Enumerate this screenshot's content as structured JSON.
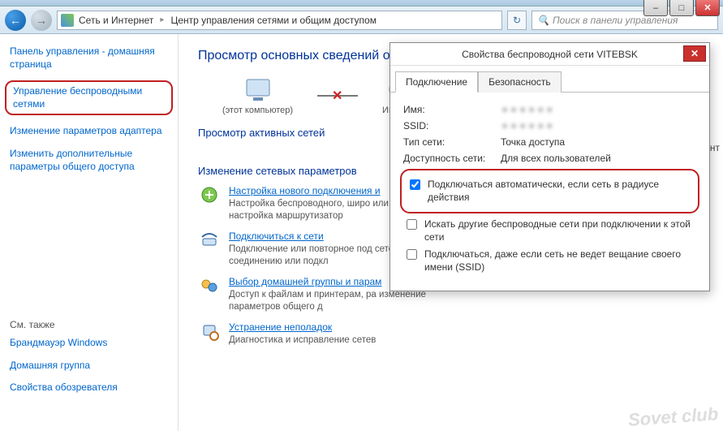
{
  "window": {
    "minimize": "–",
    "maximize": "□",
    "close": "✕"
  },
  "nav": {
    "back": "←",
    "forward": "→",
    "breadcrumb1": "Сеть и Интернет",
    "breadcrumb2": "Центр управления сетями и общим доступом",
    "refresh": "↻",
    "search_placeholder": "Поиск в панели управления",
    "search_icon": "🔍"
  },
  "sidebar": {
    "home": "Панель управления - домашняя страница",
    "wireless": "Управление беспроводными сетями",
    "adapter": "Изменение параметров адаптера",
    "sharing": "Изменить дополнительные параметры общего доступа",
    "seealso_title": "См. также",
    "seealso": {
      "firewall": "Брандмауэр Windows",
      "homegroup": "Домашняя группа",
      "browser": "Свойства обозревателя"
    }
  },
  "content": {
    "heading": "Просмотр основных сведений о с",
    "node_this": "(этот компьютер)",
    "node_internet": "Интерне",
    "active_title": "Просмотр активных сетей",
    "active_msg": "В данный момент",
    "change_title": "Изменение сетевых параметров",
    "actions": {
      "new_conn": {
        "link": "Настройка нового подключения и",
        "desc": "Настройка беспроводного, широ\nили же настройка маршрутизатор"
      },
      "connect": {
        "link": "Подключиться к сети",
        "desc": "Подключение или повторное под\nсетевому соединению или подкл"
      },
      "homegroup": {
        "link": "Выбор домашней группы и парам",
        "desc": "Доступ к файлам и принтерам, ра\nизменение параметров общего д"
      },
      "troubleshoot": {
        "link": "Устранение неполадок",
        "desc": "Диагностика и исправление сетев"
      }
    }
  },
  "dialog": {
    "title": "Свойства беспроводной сети VITEBSK",
    "close": "✕",
    "tabs": {
      "connection": "Подключение",
      "security": "Безопасность"
    },
    "props": {
      "name_label": "Имя:",
      "name_val": "∗∗∗∗∗∗",
      "ssid_label": "SSID:",
      "ssid_val": "∗∗∗∗∗∗",
      "type_label": "Тип сети:",
      "type_val": "Точка доступа",
      "avail_label": "Доступность сети:",
      "avail_val": "Для всех пользователей"
    },
    "checks": {
      "auto": "Подключаться автоматически, если сеть в радиусе действия",
      "auto_checked": true,
      "other": "Искать другие беспроводные сети при подключении к этой сети",
      "other_checked": false,
      "hidden": "Подключаться, даже если сеть не ведет вещание своего имени (SSID)",
      "hidden_checked": false
    }
  },
  "watermark": "Sovet club"
}
